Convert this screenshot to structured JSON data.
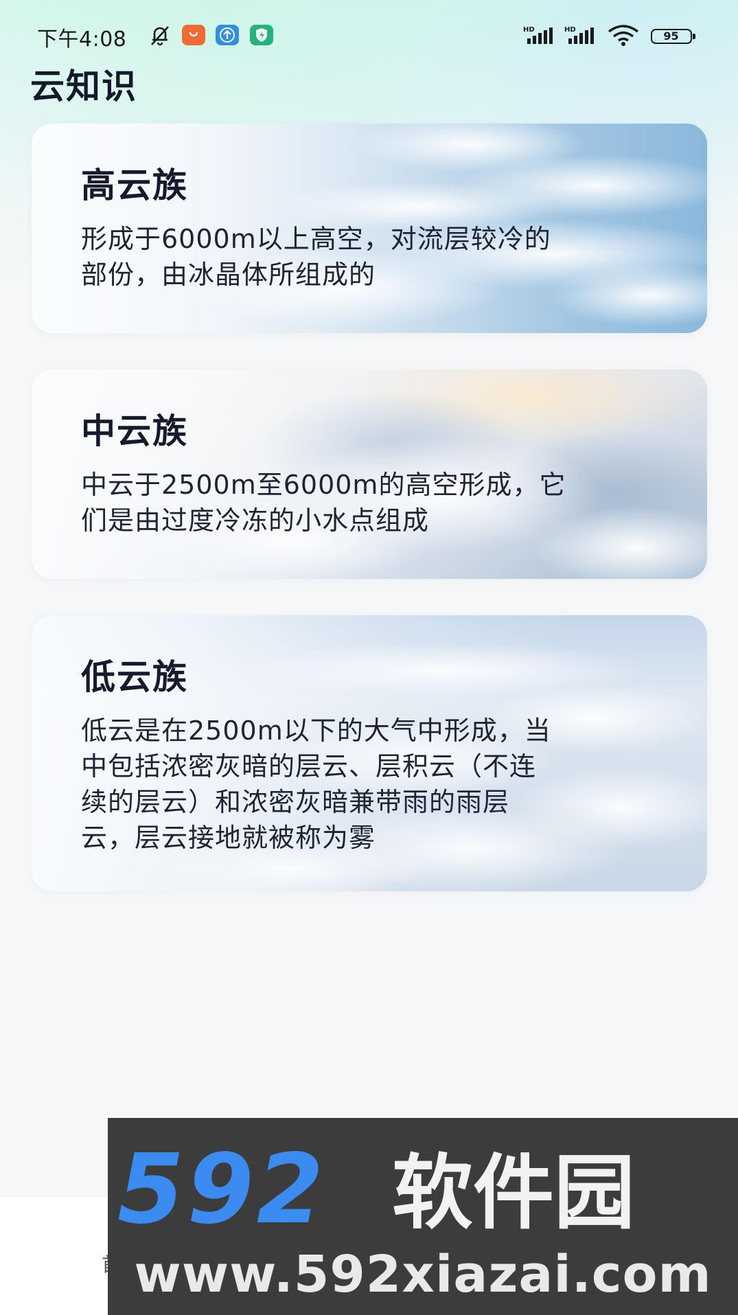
{
  "status_bar": {
    "time": "下午4:08",
    "battery": "95",
    "signal_label": "HD"
  },
  "page": {
    "title": "云知识"
  },
  "cards": [
    {
      "title": "高云族",
      "desc_lines": [
        "形成于6000m以上高空，对流层较冷的",
        "部份，由冰晶体所组成的"
      ]
    },
    {
      "title": "中云族",
      "desc_lines": [
        "中云于2500m至6000m的高空形成，它",
        "们是由过度冷冻的小水点组成"
      ]
    },
    {
      "title": "低云族",
      "desc_lines": [
        "低云是在2500m以下的大气中形成，当",
        "中包括浓密灰暗的层云、层积云（不连",
        "续的层云）和浓密灰暗兼带雨的雨层",
        "云，层云接地就被称为雾"
      ]
    }
  ],
  "bottom_nav": {
    "first_tab_label": "首"
  },
  "watermark": {
    "brand_number": "592",
    "brand_text": "软件园",
    "url": "www.592xiazai.com"
  },
  "colors": {
    "title_text": "#151b2c",
    "watermark_bg": "#3c3c3c",
    "watermark_blue": "#3b8bf0"
  },
  "icons": [
    "bell-muted-icon",
    "app-orange-icon",
    "app-blue-upload-icon",
    "app-green-shield-icon",
    "signal-icon",
    "wifi-icon",
    "battery-icon"
  ]
}
